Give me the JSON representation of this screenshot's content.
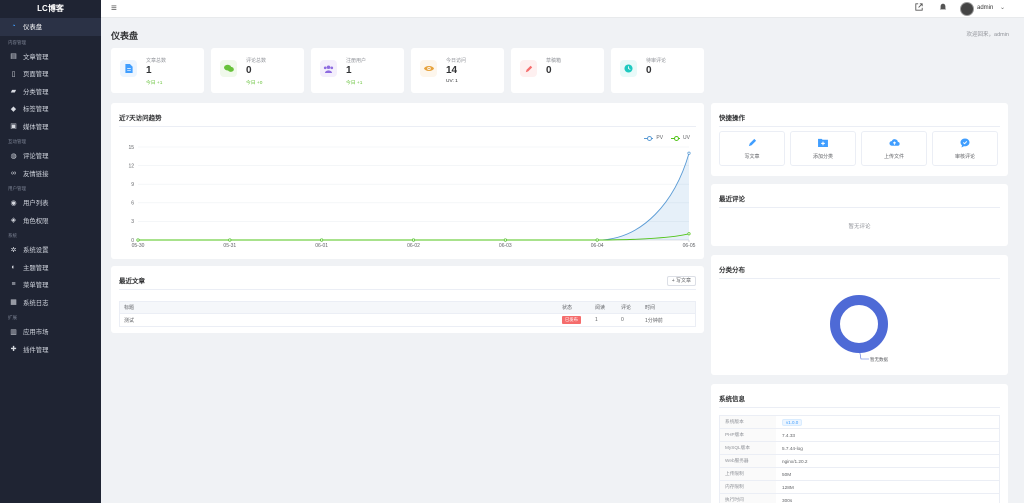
{
  "app": {
    "logo": "LC博客"
  },
  "sidebar": {
    "items": [
      {
        "label": "仪表盘",
        "icon": "dashboard-icon",
        "active": true
      },
      {
        "group": "内容管理"
      },
      {
        "label": "文章管理",
        "icon": "document-icon"
      },
      {
        "label": "页面管理",
        "icon": "page-icon"
      },
      {
        "label": "分类管理",
        "icon": "folder-icon"
      },
      {
        "label": "标签管理",
        "icon": "tag-icon"
      },
      {
        "label": "媒体管理",
        "icon": "image-icon"
      },
      {
        "group": "互动管理"
      },
      {
        "label": "评论管理",
        "icon": "comments-icon"
      },
      {
        "label": "友情链接",
        "icon": "link-icon"
      },
      {
        "group": "用户管理"
      },
      {
        "label": "用户列表",
        "icon": "users-icon"
      },
      {
        "label": "角色权限",
        "icon": "user-shield-icon"
      },
      {
        "group": "系统"
      },
      {
        "label": "系统设置",
        "icon": "gear-icon"
      },
      {
        "label": "主题管理",
        "icon": "palette-icon"
      },
      {
        "label": "菜单管理",
        "icon": "menu-icon"
      },
      {
        "label": "系统日志",
        "icon": "log-icon"
      },
      {
        "group": "扩展"
      },
      {
        "label": "应用市场",
        "icon": "store-icon"
      },
      {
        "label": "插件管理",
        "icon": "plugin-icon"
      }
    ]
  },
  "topbar": {
    "user": "admin"
  },
  "page": {
    "title": "仪表盘",
    "welcome": "欢迎回来，admin"
  },
  "stats": [
    {
      "label": "文章总数",
      "value": "1",
      "sub": "今日 +1",
      "icon": "document-icon",
      "color": "#409eff",
      "bg": "#ecf5ff"
    },
    {
      "label": "评论总数",
      "value": "0",
      "sub": "今日 +0",
      "icon": "comments-icon",
      "color": "#67c23a",
      "bg": "#f0f9eb"
    },
    {
      "label": "注册用户",
      "value": "1",
      "sub": "今日 +1",
      "icon": "users-icon",
      "color": "#8e6ce0",
      "bg": "#f4effc"
    },
    {
      "label": "今日访问",
      "value": "14",
      "sub": "UV: 1",
      "icon": "eye-icon",
      "color": "#e6a23c",
      "bg": "#fdf6ec"
    },
    {
      "label": "草稿箱",
      "value": "0",
      "sub": "",
      "icon": "pencil-icon",
      "color": "#f56c6c",
      "bg": "#fef0f0"
    },
    {
      "label": "待审评论",
      "value": "0",
      "sub": "",
      "icon": "clock-icon",
      "color": "#1ec9c0",
      "bg": "#e8faf9"
    }
  ],
  "trend": {
    "title": "近7天访问趋势",
    "legend": {
      "pv": "PV",
      "uv": "UV"
    }
  },
  "chart_data": {
    "type": "line",
    "categories": [
      "05-30",
      "05-31",
      "06-01",
      "06-02",
      "06-03",
      "06-04",
      "06-05"
    ],
    "series": [
      {
        "name": "PV",
        "values": [
          0,
          0,
          0,
          0,
          0,
          0,
          14
        ],
        "color": "#5a9bd5"
      },
      {
        "name": "UV",
        "values": [
          0,
          0,
          0,
          0,
          0,
          0,
          1
        ],
        "color": "#52c41a"
      }
    ],
    "yticks": [
      0,
      3,
      6,
      9,
      12,
      15
    ],
    "ylim": [
      0,
      15
    ],
    "grid": true,
    "legend": "top-right"
  },
  "recent": {
    "title": "最近文章",
    "write_btn": "+ 写文章",
    "headers": [
      "标题",
      "状态",
      "阅读",
      "评论",
      "时间"
    ],
    "rows": [
      {
        "title": "测试",
        "status": "已发布",
        "views": "1",
        "comments": "0",
        "time": "1分钟前"
      }
    ]
  },
  "quick": {
    "title": "快捷操作",
    "actions": [
      {
        "label": "写文章",
        "icon": "pen-icon"
      },
      {
        "label": "添加分类",
        "icon": "folder-plus-icon"
      },
      {
        "label": "上传文件",
        "icon": "cloud-upload-icon"
      },
      {
        "label": "审核评论",
        "icon": "comment-check-icon"
      }
    ]
  },
  "latest_comments": {
    "title": "最近评论",
    "empty": "暂无评论"
  },
  "category_dist": {
    "title": "分类分布",
    "empty_label": "暂无数据",
    "color": "#4e6ad6"
  },
  "sysinfo": {
    "title": "系统信息",
    "rows": [
      {
        "k": "系统版本",
        "v": "v1.0.0",
        "tag": true
      },
      {
        "k": "PHP版本",
        "v": "7.4.33"
      },
      {
        "k": "MySQL版本",
        "v": "5.7.44-log"
      },
      {
        "k": "Web服务器",
        "v": "nginx/1.20.2"
      },
      {
        "k": "上传限制",
        "v": "50M"
      },
      {
        "k": "内存限制",
        "v": "128M"
      },
      {
        "k": "执行时间",
        "v": "300s"
      }
    ]
  }
}
